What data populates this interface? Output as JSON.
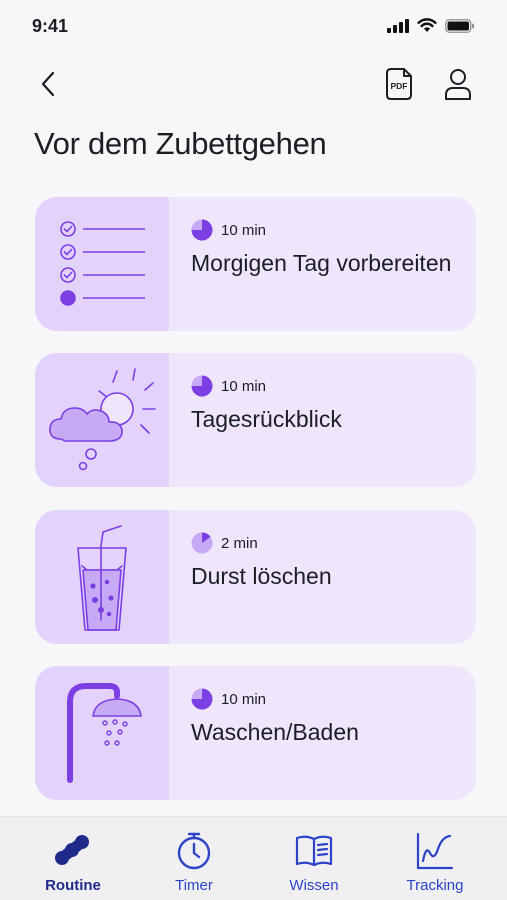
{
  "status_bar": {
    "time": "9:41"
  },
  "nav": {
    "pdf_label": "PDF"
  },
  "page": {
    "title": "Vor dem Zubettgehen"
  },
  "cards": [
    {
      "duration": "10 min",
      "title": "Morgigen Tag vorbereiten",
      "illustration": "checklist-illustration"
    },
    {
      "duration": "10 min",
      "title": "Tagesrückblick",
      "illustration": "cloud-sun-illustration"
    },
    {
      "duration": "2 min",
      "title": "Durst löschen",
      "illustration": "water-glass-illustration"
    },
    {
      "duration": "10 min",
      "title": "Waschen/Baden",
      "illustration": "shower-illustration"
    }
  ],
  "tabs": [
    {
      "label": "Routine",
      "icon": "routine-icon",
      "active": true
    },
    {
      "label": "Timer",
      "icon": "stopwatch-icon",
      "active": false
    },
    {
      "label": "Wissen",
      "icon": "book-icon",
      "active": false
    },
    {
      "label": "Tracking",
      "icon": "chart-icon",
      "active": false
    }
  ],
  "colors": {
    "accent": "#7b3fe4",
    "card_bg": "#efe6fc",
    "illustration_bg": "#e3d2fb",
    "tab_active": "#1f2a8a",
    "tab": "#2d43c8"
  }
}
